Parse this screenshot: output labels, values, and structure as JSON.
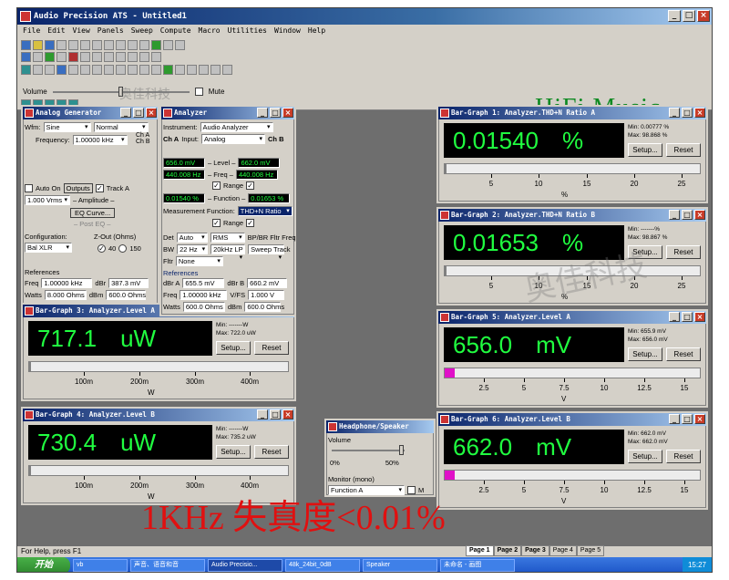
{
  "window": {
    "title": "Audio Precision ATS - Untitled1"
  },
  "menu": [
    "File",
    "Edit",
    "View",
    "Panels",
    "Sweep",
    "Compute",
    "Macro",
    "Utilities",
    "Window",
    "Help"
  ],
  "volume_label": "Volume",
  "mute_label": "Mute",
  "brand_text": "HiFi Music",
  "analog_generator": {
    "title": "Analog Generator",
    "wfm_label": "Wfm:",
    "wfm_value": "Sine",
    "wfm_mode": "Normal",
    "frequency_label": "Frequency:",
    "frequency_value": "1.00000 kHz",
    "cha": "Ch A",
    "chb": "Ch B",
    "auto_on": "Auto On",
    "outputs": "Outputs",
    "track_a": "Track A",
    "amplitude_value": "1.000   Vrms",
    "amplitude_label": "– Amplitude –",
    "eq_curve": "EQ Curve...",
    "post_eq": "– Post EQ –",
    "configuration_label": "Configuration:",
    "configuration_value": "Bal XLR",
    "zout_label": "Z-Out (Ohms)",
    "zout_40": "40",
    "zout_150": "150",
    "references_label": "References",
    "freq_label": "Freq",
    "freq_ref": "1.00000 kHz",
    "dbr_label": "dBr",
    "dbr_ref": "387.3  mV",
    "watts_label": "Watts",
    "watts_ref": "8.000   Ohms",
    "dbm_label": "dBm",
    "dbm_ref": "600.0   Ohms"
  },
  "analyzer": {
    "title": "Analyzer",
    "instrument_label": "Instrument:",
    "instrument_value": "Audio Analyzer",
    "cha": "Ch A",
    "input_label": "Input:",
    "input_value": "Analog",
    "chb": "Ch B",
    "level_a": "656.0  mV",
    "level_b": "662.0  mV",
    "level_label": "– Level –",
    "freq_a": "440.008  Hz",
    "freq_b": "440.008  Hz",
    "freq_label": "– Freq –",
    "range_label": "Range",
    "function_a": "0.01540  %",
    "function_b": "0.01653  %",
    "function_label": "– Function –",
    "measurement_label": "Measurement Function:",
    "measurement_value": "THD+N Ratio",
    "det_label": "Det",
    "det_value": "Auto",
    "rms_value": "RMS",
    "bp_label": "BP/BR Fltr Freq",
    "bw_label": "BW",
    "bw_value": "22 Hz",
    "lp_value": "20kHz LP",
    "sweep_track": "Sweep Track",
    "fltr_label": "Fltr",
    "fltr_value": "None",
    "references_label": "References",
    "dbr_a_label": "dBr A",
    "dbr_a": "655.5  mV",
    "dbr_b_label": "dBr B",
    "dbr_b": "660.2  mV",
    "freq_ref_label": "Freq",
    "freq_ref": "1.00000 kHz",
    "vfs_label": "V/FS",
    "vfs": "1.000   V",
    "watts_label": "Watts",
    "watts": "600.0   Ohms",
    "dbm_label": "dBm",
    "dbm": "600.0   Ohms"
  },
  "bar_graphs": {
    "bg1": {
      "title": "Bar-Graph 1: Analyzer.THD+N Ratio A",
      "value": "0.01540",
      "unit": "%",
      "min": "Min:  0.00777  %",
      "max": "Max:  98.868  %",
      "setup": "Setup...",
      "reset": "Reset",
      "ticks": [
        "5",
        "10",
        "15",
        "20",
        "25"
      ],
      "axis_unit": "%",
      "fill": 0
    },
    "bg2": {
      "title": "Bar-Graph 2: Analyzer.THD+N Ratio B",
      "value": "0.01653",
      "unit": "%",
      "min": "Min:  -------%",
      "max": "Max:  98.867  %",
      "setup": "Setup...",
      "reset": "Reset",
      "ticks": [
        "5",
        "10",
        "15",
        "20",
        "25"
      ],
      "axis_unit": "%",
      "fill": 0
    },
    "bg3": {
      "title": "Bar-Graph 3: Analyzer.Level A",
      "value": "717.1",
      "unit": "uW",
      "min": "Min:  -------W",
      "max": "Max:  722.0   uW",
      "setup": "Setup...",
      "reset": "Reset",
      "ticks": [
        "100m",
        "200m",
        "300m",
        "400m"
      ],
      "axis_unit": "W",
      "fill": 0
    },
    "bg4": {
      "title": "Bar-Graph 4: Analyzer.Level B",
      "value": "730.4",
      "unit": "uW",
      "min": "Min:  -------W",
      "max": "Max:  735.2   uW",
      "setup": "Setup...",
      "reset": "Reset",
      "ticks": [
        "100m",
        "200m",
        "300m",
        "400m"
      ],
      "axis_unit": "W",
      "fill": 0
    },
    "bg5": {
      "title": "Bar-Graph 5: Analyzer.Level A",
      "value": "656.0",
      "unit": "mV",
      "min": "Min:  655.9   mV",
      "max": "Max:  656.0   mV",
      "setup": "Setup...",
      "reset": "Reset",
      "ticks": [
        "2.5",
        "5",
        "7.5",
        "10",
        "12.5",
        "15"
      ],
      "axis_unit": "V",
      "fill": 0.04
    },
    "bg6": {
      "title": "Bar-Graph 6: Analyzer.Level B",
      "value": "662.0",
      "unit": "mV",
      "min": "Min:  662.0   mV",
      "max": "Max:  662.0   mV",
      "setup": "Setup...",
      "reset": "Reset",
      "ticks": [
        "2.5",
        "5",
        "7.5",
        "10",
        "12.5",
        "15"
      ],
      "axis_unit": "V",
      "fill": 0.04
    }
  },
  "headphone": {
    "title": "Headphone/Speaker",
    "volume_label": "Volume",
    "scale_0": "0%",
    "scale_50": "50%",
    "monitor_label": "Monitor (mono)",
    "monitor_value": "Function A",
    "cut": "M"
  },
  "status": {
    "help": "For Help, press F1"
  },
  "page_tabs": [
    "Page 1",
    "Page 2",
    "Page 3",
    "Page 4",
    "Page 5"
  ],
  "taskbar": {
    "start": "开始",
    "items": [
      "vb",
      "声音、语音和音",
      "Audio Precisio...",
      "48k_24bit_0dB",
      "Speaker",
      "未命名 - 画图"
    ],
    "clock": "15:27"
  },
  "overlay_text": "1KHz  失真度<0.01%",
  "watermark_text": "奥佳科技",
  "colors": {
    "display_bg": "#000000",
    "display_text": "#20ff40",
    "title_blue": "#0a246a",
    "overlay_red": "#e01010",
    "brand_green": "#0e8a22"
  }
}
